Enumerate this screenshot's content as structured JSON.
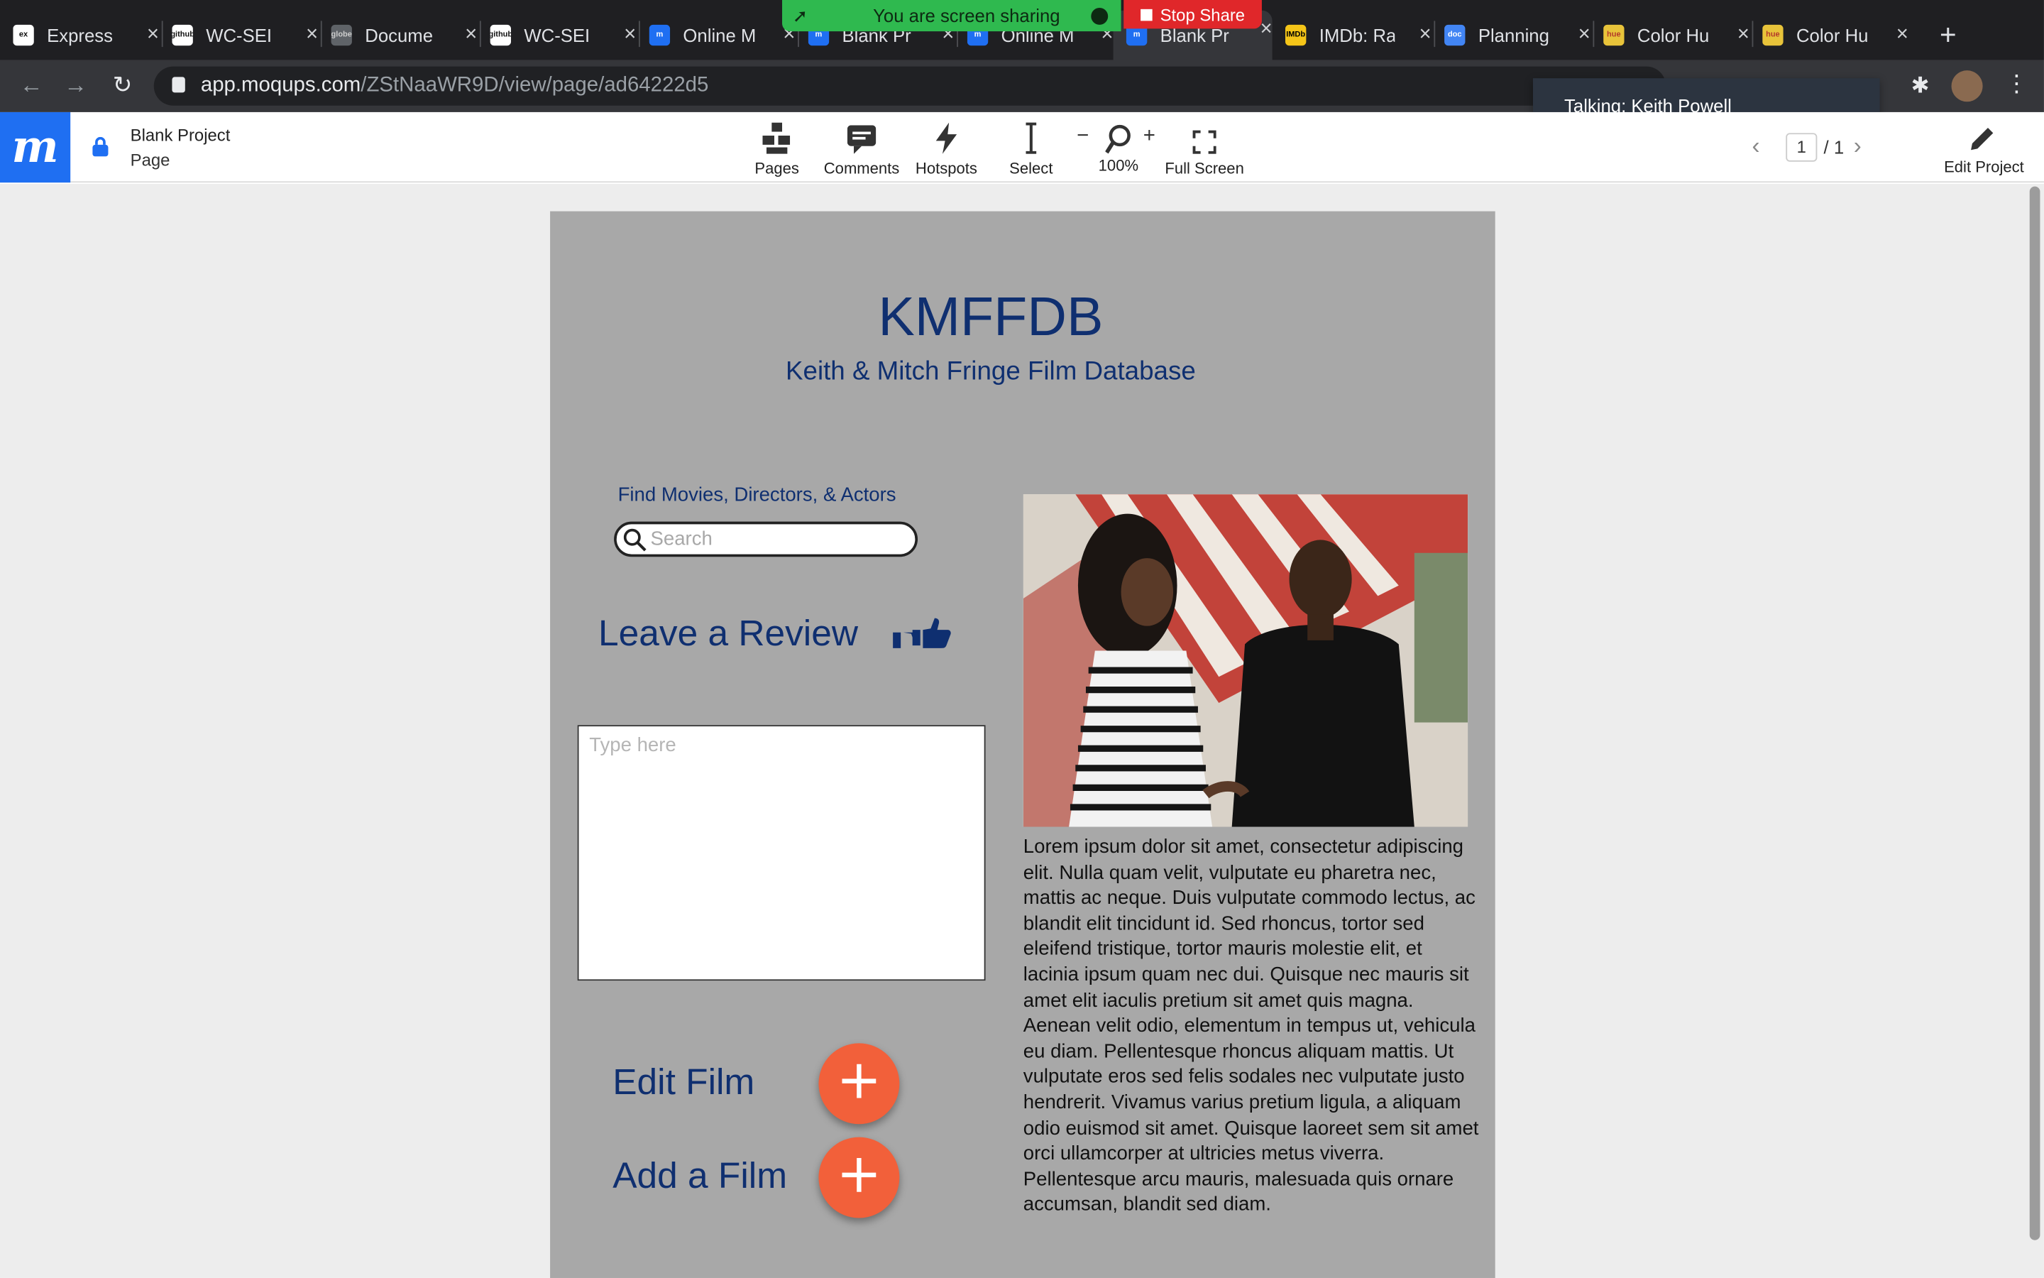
{
  "browser": {
    "tabs": [
      {
        "label": "Express",
        "favicon": "ex",
        "favicon_bg": "#ffffff",
        "favicon_fg": "#111111"
      },
      {
        "label": "WC-SEI",
        "favicon": "github",
        "favicon_bg": "#ffffff",
        "favicon_fg": "#111111"
      },
      {
        "label": "Docume",
        "favicon": "globe",
        "favicon_bg": "#5f6368",
        "favicon_fg": "#cccccc"
      },
      {
        "label": "WC-SEI",
        "favicon": "github",
        "favicon_bg": "#ffffff",
        "favicon_fg": "#111111"
      },
      {
        "label": "Online M",
        "favicon": "m",
        "favicon_bg": "#1f6ff2",
        "favicon_fg": "#ffffff"
      },
      {
        "label": "Blank Pr",
        "favicon": "m",
        "favicon_bg": "#1f6ff2",
        "favicon_fg": "#ffffff"
      },
      {
        "label": "Online M",
        "favicon": "m",
        "favicon_bg": "#1f6ff2",
        "favicon_fg": "#ffffff"
      },
      {
        "label": "Blank Pr",
        "favicon": "m",
        "favicon_bg": "#1f6ff2",
        "favicon_fg": "#ffffff",
        "active": true
      },
      {
        "label": "IMDb: Ra",
        "favicon": "IMDb",
        "favicon_bg": "#f5c518",
        "favicon_fg": "#000000"
      },
      {
        "label": "Planning",
        "favicon": "doc",
        "favicon_bg": "#4285f4",
        "favicon_fg": "#ffffff"
      },
      {
        "label": "Color Hu",
        "favicon": "hue",
        "favicon_bg": "#e8c33a",
        "favicon_fg": "#b33a2a"
      },
      {
        "label": "Color Hu",
        "favicon": "hue",
        "favicon_bg": "#e8c33a",
        "favicon_fg": "#b33a2a"
      }
    ],
    "sharing": {
      "text": "You are screen sharing",
      "stop_label": "Stop Share"
    },
    "url_host": "app.moqups.com",
    "url_path": "/ZStNaaWR9D/view/page/ad64222d5",
    "talking": "Talking: Keith Powell"
  },
  "moqups": {
    "logo": "m",
    "project_title": "Blank Project",
    "page_label": "Page",
    "tools": [
      {
        "label": "Pages",
        "icon": "pages-icon"
      },
      {
        "label": "Comments",
        "icon": "comments-icon"
      },
      {
        "label": "Hotspots",
        "icon": "hotspots-icon"
      },
      {
        "label": "Select",
        "icon": "select-icon"
      }
    ],
    "zoom": "100%",
    "zoom_minus": "−",
    "zoom_plus": "+",
    "fullscreen_label": "Full Screen",
    "page_current": "1",
    "page_total": "/ 1",
    "edit_label": "Edit Project",
    "accent": "#1f6ff2"
  },
  "mockup": {
    "title": "KMFFDB",
    "subtitle": "Keith & Mitch Fringe Film Database",
    "find_label": "Find Movies, Directors, & Actors",
    "search_placeholder": "Search",
    "review_heading": "Leave a Review",
    "review_placeholder": "Type here",
    "edit_film": "Edit Film",
    "add_film": "Add a Film",
    "fab_color": "#f2603a",
    "text_color": "#0f2f70",
    "lorem": "Lorem ipsum dolor sit amet, consectetur adipiscing elit. Nulla quam velit, vulputate eu pharetra nec, mattis ac neque. Duis vulputate commodo lectus, ac blandit elit tincidunt id. Sed rhoncus, tortor sed eleifend tristique, tortor mauris molestie elit, et lacinia ipsum quam nec dui. Quisque nec mauris sit amet elit iaculis pretium sit amet quis magna. Aenean velit odio, elementum in tempus ut, vehicula eu diam. Pellentesque rhoncus aliquam mattis. Ut vulputate eros sed felis sodales nec vulputate justo hendrerit. Vivamus varius pretium ligula, a aliquam odio euismod sit amet. Quisque laoreet sem sit amet orci ullamcorper at ultricies metus viverra. Pellentesque arcu mauris, malesuada quis ornare accumsan, blandit sed diam."
  }
}
